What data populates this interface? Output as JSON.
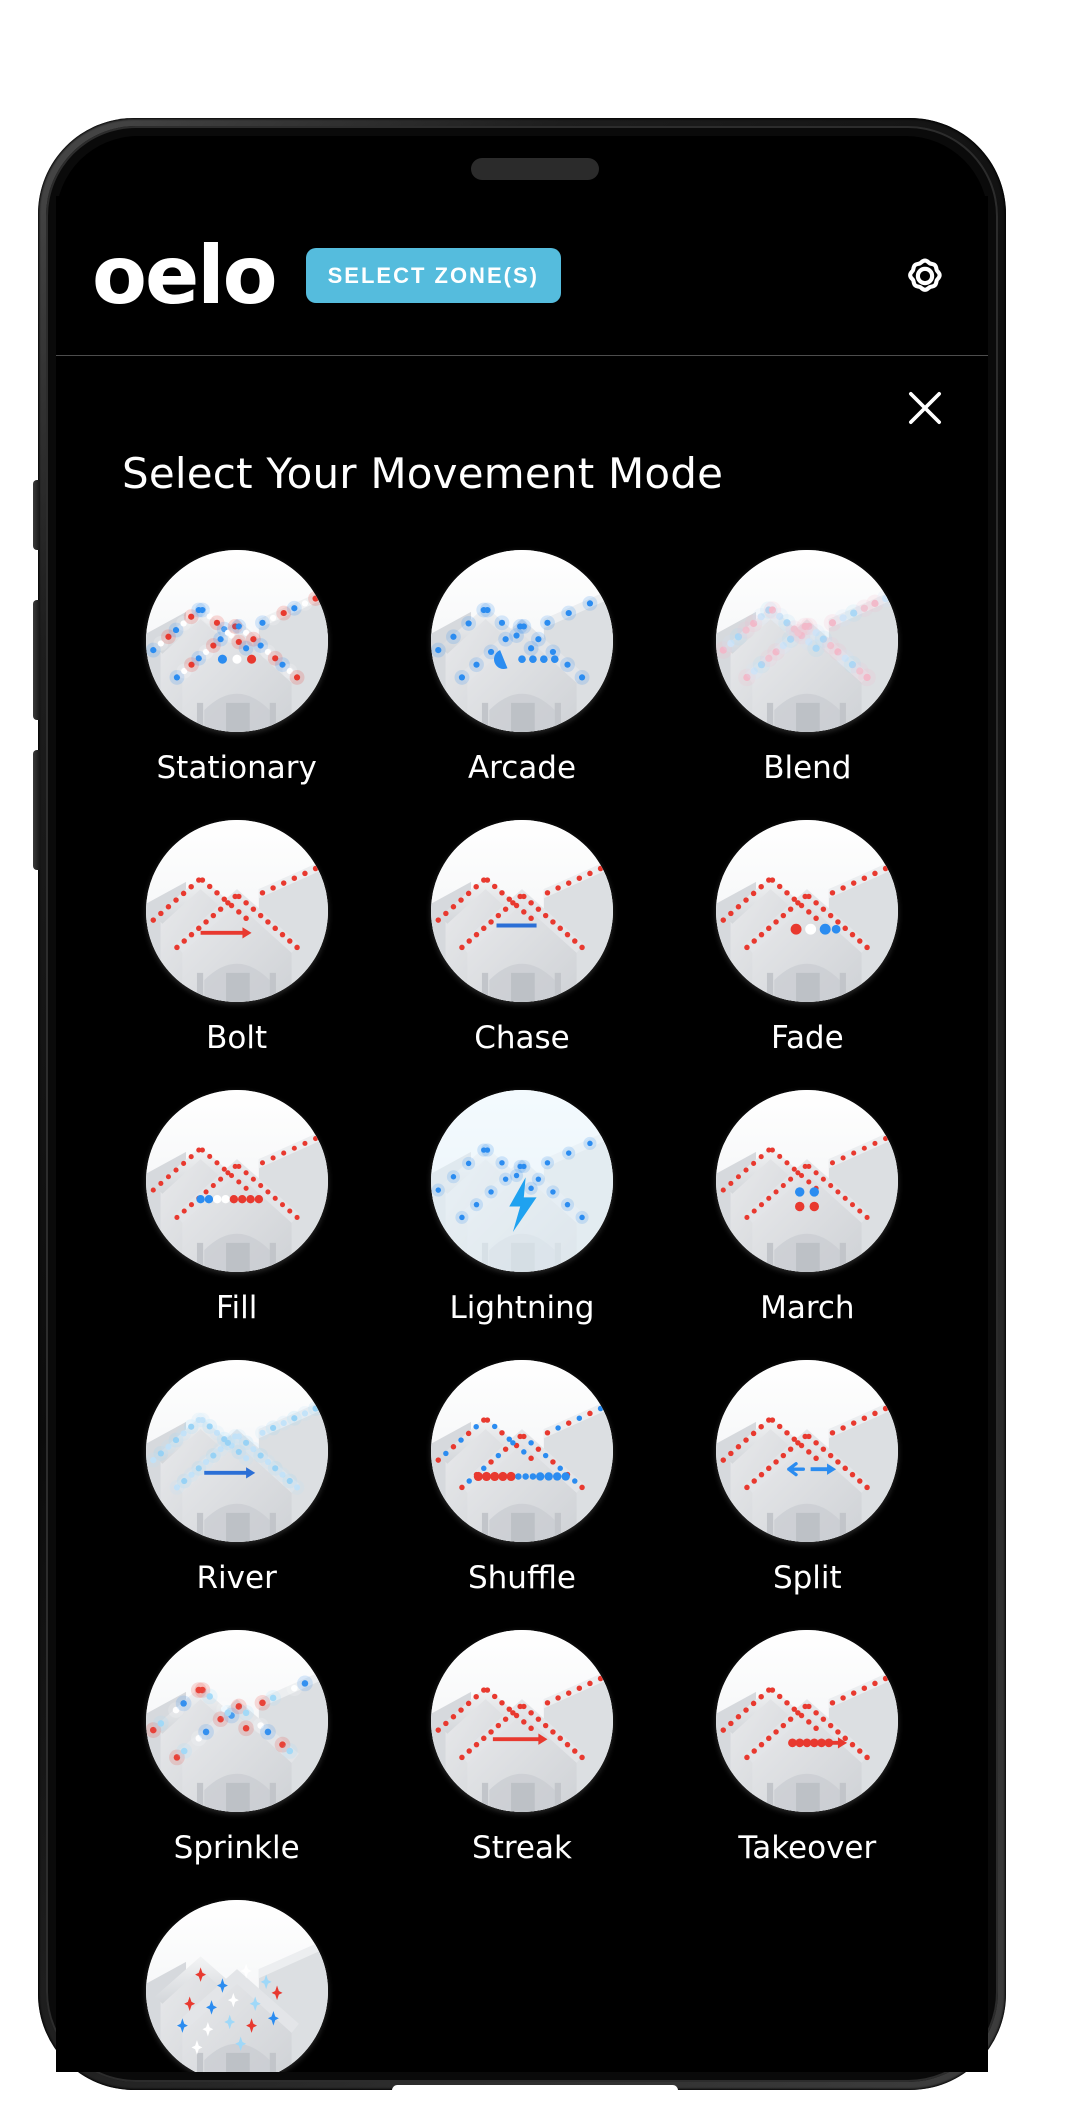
{
  "header": {
    "logo": "oelo",
    "zone_button": "SELECT ZONE(S)",
    "gear_icon": "gear-icon",
    "accent_color": "#55bcdd"
  },
  "panel": {
    "title": "Select Your Movement Mode",
    "close_icon": "close-icon"
  },
  "modes": [
    {
      "label": "Stationary",
      "art": "dots",
      "accent": "#2b8cf0"
    },
    {
      "label": "Arcade",
      "art": "pacman",
      "accent": "#2196f3"
    },
    {
      "label": "Blend",
      "art": "blend",
      "accent": "#8fd4f5"
    },
    {
      "label": "Bolt",
      "art": "arrow",
      "accent": "#e8392f"
    },
    {
      "label": "Chase",
      "art": "chase",
      "accent": "#2b6fd6"
    },
    {
      "label": "Fade",
      "art": "fade",
      "accent": "#e8392f"
    },
    {
      "label": "Fill",
      "art": "fill",
      "accent": "#2b8cf0"
    },
    {
      "label": "Lightning",
      "art": "lightning",
      "accent": "#1fa2f0"
    },
    {
      "label": "March",
      "art": "march",
      "accent": "#2b8cf0"
    },
    {
      "label": "River",
      "art": "river",
      "accent": "#2b6fd6"
    },
    {
      "label": "Shuffle",
      "art": "shuffle",
      "accent": "#e8392f"
    },
    {
      "label": "Split",
      "art": "split",
      "accent": "#2b8cf0"
    },
    {
      "label": "Sprinkle",
      "art": "sprinkle",
      "accent": "#7fc6f5"
    },
    {
      "label": "Streak",
      "art": "streak",
      "accent": "#e8392f"
    },
    {
      "label": "Takeover",
      "art": "takeover",
      "accent": "#e8392f"
    },
    {
      "label": "",
      "art": "twinkle",
      "accent": "#7fc6f5"
    }
  ],
  "colors": {
    "screen_background": "#000000",
    "text": "#ffffff",
    "divider": "#4d4d4d",
    "led_red": "#e8392f",
    "led_blue": "#2b8cf0",
    "led_white": "#ffffff"
  }
}
